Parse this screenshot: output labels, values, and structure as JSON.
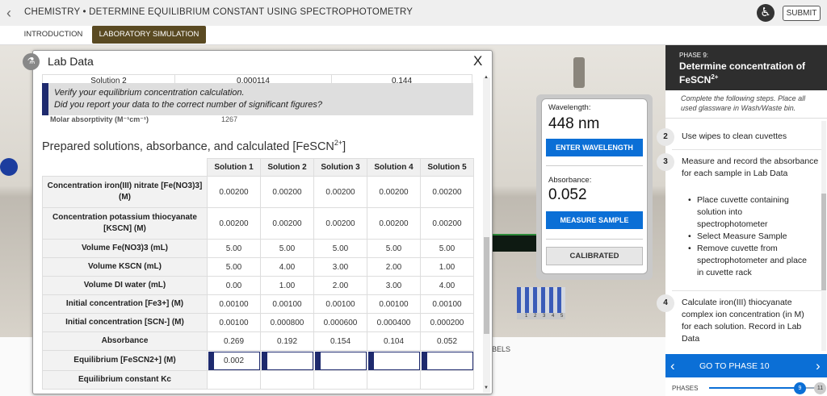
{
  "header": {
    "back_icon": "chevron-left-icon",
    "title": "CHEMISTRY • DETERMINE EQUILIBRIUM CONSTANT USING SPECTROPHOTOMETRY",
    "accessibility_icon": "accessibility-icon",
    "submit_label": "SUBMIT"
  },
  "tabs": [
    {
      "label": "INTRODUCTION",
      "active": false
    },
    {
      "label": "LABORATORY SIMULATION",
      "active": true
    }
  ],
  "scene": {
    "waste_label": "BELS",
    "rack_numbers": "1 2 3 4 5"
  },
  "spectrophotometer": {
    "wavelength_label": "Wavelength:",
    "wavelength_value": "448 nm",
    "enter_wavelength_label": "ENTER WAVELENGTH",
    "absorbance_label": "Absorbance:",
    "absorbance_value": "0.052",
    "measure_label": "MEASURE SAMPLE",
    "calibrated_label": "CALIBRATED"
  },
  "lab_data": {
    "title": "Lab Data",
    "close_label": "X",
    "partial_row": {
      "label": "Solution 2",
      "values": [
        "0.000114",
        "0.144"
      ]
    },
    "notice": {
      "line1": "Verify your equilibrium concentration calculation.",
      "line2": "Did you report your data to the correct number of significant figures?"
    },
    "molar_row": {
      "label": "Molar absorptivity (M⁻¹cm⁻¹)",
      "value": "1267"
    },
    "section_title": "Prepared solutions, absorbance, and calculated [FeSCN",
    "section_title_sup": "2+",
    "section_title_end": "]",
    "columns": [
      "Solution 1",
      "Solution 2",
      "Solution 3",
      "Solution 4",
      "Solution 5"
    ],
    "rows": [
      {
        "label": "Concentration iron(III) nitrate [Fe(NO3)3] (M)",
        "values": [
          "0.00200",
          "0.00200",
          "0.00200",
          "0.00200",
          "0.00200"
        ]
      },
      {
        "label": "Concentration potassium thiocyanate [KSCN] (M)",
        "values": [
          "0.00200",
          "0.00200",
          "0.00200",
          "0.00200",
          "0.00200"
        ]
      },
      {
        "label": "Volume Fe(NO3)3 (mL)",
        "values": [
          "5.00",
          "5.00",
          "5.00",
          "5.00",
          "5.00"
        ]
      },
      {
        "label": "Volume KSCN (mL)",
        "values": [
          "5.00",
          "4.00",
          "3.00",
          "2.00",
          "1.00"
        ]
      },
      {
        "label": "Volume DI water (mL)",
        "values": [
          "0.00",
          "1.00",
          "2.00",
          "3.00",
          "4.00"
        ]
      },
      {
        "label": "Initial concentration [Fe3+] (M)",
        "values": [
          "0.00100",
          "0.00100",
          "0.00100",
          "0.00100",
          "0.00100"
        ]
      },
      {
        "label": "Initial concentration [SCN-] (M)",
        "values": [
          "0.00100",
          "0.000800",
          "0.000600",
          "0.000400",
          "0.000200"
        ]
      },
      {
        "label": "Absorbance",
        "values": [
          "0.269",
          "0.192",
          "0.154",
          "0.104",
          "0.052"
        ]
      }
    ],
    "equilibrium_row": {
      "label": "Equilibrium [FeSCN2+] (M)",
      "values": [
        "0.002",
        "",
        "",
        "",
        ""
      ]
    },
    "constant_row": {
      "label": "Equilibrium constant Kc"
    }
  },
  "phase": {
    "number_label": "PHASE 9:",
    "title": "Determine concentration of FeSCN",
    "title_sup": "2+",
    "intro": "Complete the following steps. Place all used glassware in Wash/Waste bin.",
    "steps": [
      {
        "num": "2",
        "text": "Use wipes to clean cuvettes"
      },
      {
        "num": "3",
        "text": "Measure and record the absorbance for each sample in Lab Data",
        "bullets": [
          "Place cuvette containing solution into spectrophotometer",
          "Select Measure Sample",
          "Remove cuvette from spectrophotometer and place in cuvette rack"
        ]
      },
      {
        "num": "4",
        "text": "Calculate iron(III) thiocyanate complex ion concentration (in M) for each solution. Record in Lab Data"
      }
    ],
    "goto_label": "GO TO PHASE 10",
    "phases_label": "PHASES",
    "current_phase": "9",
    "total_phases": "11",
    "progress": 0.8
  }
}
